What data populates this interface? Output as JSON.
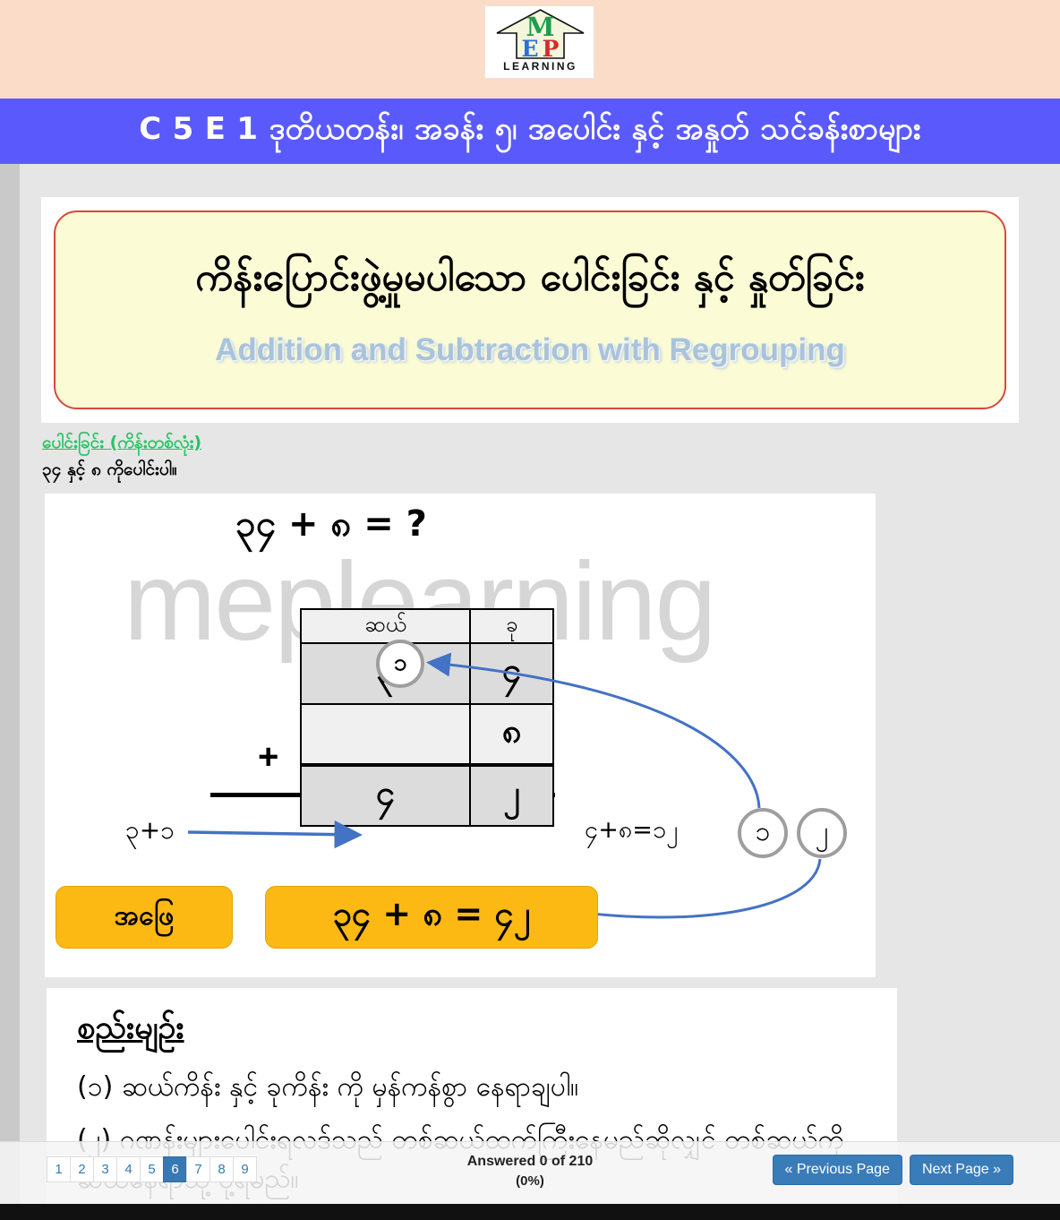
{
  "header": {
    "logo": {
      "letters": [
        "M",
        "E",
        "P"
      ],
      "letter_colors": [
        "#1f9d4e",
        "#2b6fd4",
        "#d32b2b"
      ],
      "word": "LEARNING",
      "band_color": "#fadcc8"
    },
    "banner": {
      "title": "C 5 E 1 ဒုတိယတန်း၊ အခန်း ၅၊ အပေါင်း နှင့် အနှုတ် သင်ခန်းစာများ",
      "bg_color": "#5a5afc",
      "text_color": "#ffffff"
    }
  },
  "lesson_title": {
    "burmese": "ကိန်းပြောင်းဖွဲ့မှုမပါသော ပေါင်းခြင်း နှင့် နှုတ်ခြင်း",
    "english": "Addition and Subtraction with Regrouping",
    "bg_color": "#fbfbd5",
    "border_color": "#d8483b"
  },
  "question": {
    "section_link": "ပေါင်းခြင်း (ကိန်းတစ်လုံး)",
    "section_link_color": "#25c463",
    "prompt": "၃၄ နှင့် ၈ ကိုပေါင်းပါ။"
  },
  "figure": {
    "watermark": "meplearning",
    "equation_top": "၃၄ + ၈ = ?",
    "plus_sign": "+",
    "carry_bubble": "၁",
    "note_left": "၃+၁",
    "note_right": "၄+၈=၁၂",
    "result_bubble_1": "၁",
    "result_bubble_2": "၂",
    "table": {
      "headers": [
        "ဆယ်",
        "ခု"
      ],
      "rows": [
        [
          "၃",
          "၄"
        ],
        [
          "",
          "၈"
        ],
        [
          "၄",
          "၂"
        ]
      ]
    },
    "buttons": {
      "answer_label": "အဖြေ",
      "result_label": "၃၄ + ၈ = ၄၂",
      "color": "#fcb913"
    }
  },
  "rules": {
    "title": "စည်းမျဉ်း",
    "items": [
      "(၁) ဆယ်ကိန်း နှင့် ခုကိန်း ကို မှန်ကန်စွာ နေရာချပါ။",
      "(၂) ဂဏန်းများပေါင်းရလဒ်သည် တစ်ဆယ်ထက်ကြီးနေမည်ဆိုလျှင် တစ်ဆယ်ကို ဆယ်နေရာသို့ ပို့ရမည်။"
    ]
  },
  "footer": {
    "pages": [
      "1",
      "2",
      "3",
      "4",
      "5",
      "6",
      "7",
      "8",
      "9"
    ],
    "active_page": "6",
    "answered_text": "Answered 0 of 210",
    "answered_percent": "(0%)",
    "prev_label": "« Previous Page",
    "next_label": "Next Page »",
    "button_color": "#3a7cb8"
  }
}
